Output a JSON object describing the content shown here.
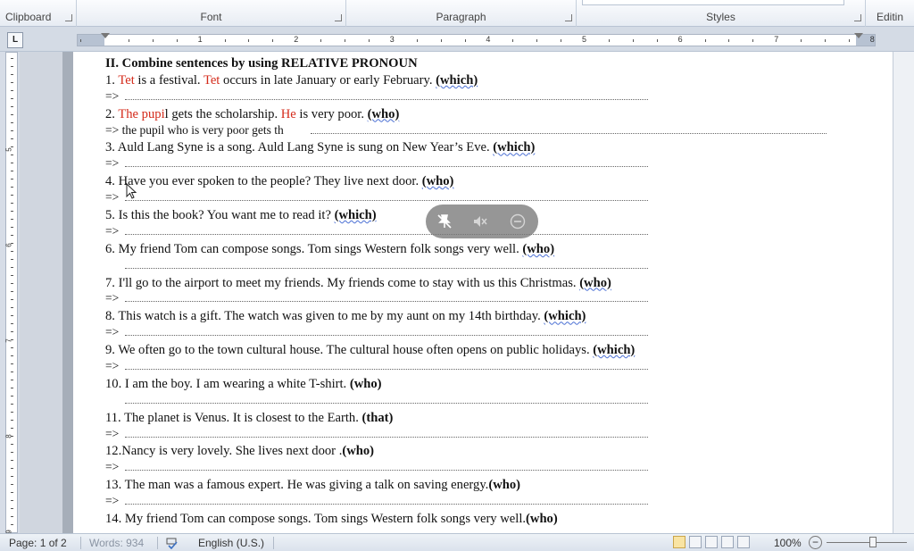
{
  "ribbon": {
    "groups": [
      {
        "label": "Clipboard"
      },
      {
        "label": "Font"
      },
      {
        "label": "Paragraph"
      },
      {
        "label": "Styles"
      },
      {
        "label": "Editin"
      }
    ]
  },
  "ruler": {
    "tab_selector": "L",
    "numbers": [
      "1",
      "2",
      "3",
      "4",
      "5",
      "6",
      "7",
      "8"
    ],
    "v_numbers": [
      "5",
      "6",
      "7",
      "8",
      "9"
    ]
  },
  "document": {
    "heading": "II. Combine sentences by using RELATIVE PRONOUN",
    "arrow": "=>",
    "q1": {
      "num": "1. ",
      "red1": "Tet",
      "t1": " is a festival. ",
      "red2": "Tet",
      "t2": " occurs in late January or early February. ",
      "kw": "(which)"
    },
    "q2": {
      "num": "2. ",
      "red1": "The pupi",
      "t1": "l gets the scholarship. ",
      "red2": "He",
      "t2": " is very poor. ",
      "kw": "(who)",
      "answer": " the pupil who is very poor gets th"
    },
    "q3": {
      "t": "3. Auld Lang Syne is a song. Auld Lang Syne is sung on New Year’s Eve. ",
      "kw": "(which)"
    },
    "q4": {
      "t": "4. Have you ever spoken to the people? They live next door. ",
      "kw": "(who)"
    },
    "q5": {
      "t": "5. Is this the book? You want me to read it? ",
      "kw": "(which)"
    },
    "q6": {
      "t": "6. My friend Tom can compose songs. Tom sings Western folk songs very well. ",
      "kw": "(who)"
    },
    "q7": {
      "t": "7. I'll go to the airport to meet my friends. My friends come to stay with us this Christmas. ",
      "kw": "(who)"
    },
    "q8": {
      "t": "8. This watch is a gift. The watch was given to me by my aunt on my 14th birthday. ",
      "kw": "(which)"
    },
    "q9": {
      "t": "9. We often go to the town cultural house. The cultural house often opens on public holidays. ",
      "kw": "(which)"
    },
    "q10": {
      "t": "10. I am the boy. I am wearing a white T-shirt. ",
      "kw": "(who)"
    },
    "q11": {
      "t": " 11. The planet is Venus. It is closest to the Earth. ",
      "kw": "(that)"
    },
    "q12": {
      "t": "12.Nancy is very lovely. She lives next door .",
      "kw": "(who)"
    },
    "q13": {
      "t": "13. The man was a famous expert. He was giving a talk on saving energy.",
      "kw": "(who)"
    },
    "q14": {
      "t": "14. My friend Tom can compose songs. Tom sings Western folk songs very well.",
      "kw": "(who)"
    }
  },
  "status": {
    "page": "Page: 1 of 2",
    "words": "Words: 934",
    "language": "English (U.S.)",
    "zoom": "100%"
  }
}
